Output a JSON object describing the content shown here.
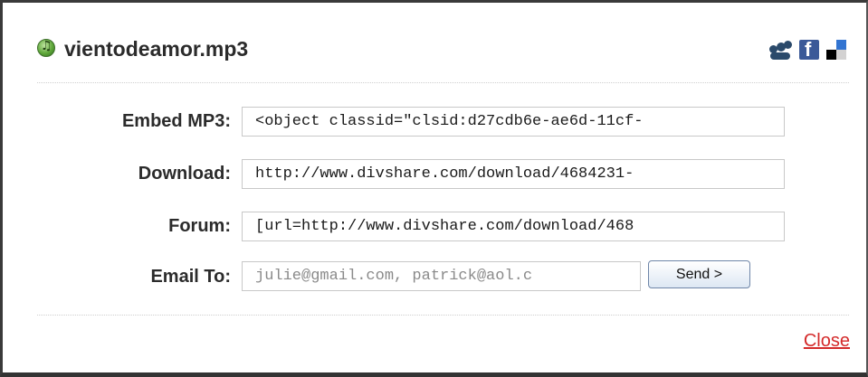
{
  "dialog": {
    "title": "vientodeamor.mp3",
    "file_icon": "music-file-icon",
    "share_icons": [
      "myspace-icon",
      "facebook-icon",
      "delicious-icon"
    ]
  },
  "rows": [
    {
      "label": "Embed MP3:",
      "value": "<object classid=\"clsid:d27cdb6e-ae6d-11cf-"
    },
    {
      "label": "Download:",
      "value": "http://www.divshare.com/download/4684231-"
    },
    {
      "label": "Forum:",
      "value": "[url=http://www.divshare.com/download/468"
    }
  ],
  "email": {
    "label": "Email To:",
    "placeholder": "julie@gmail.com, patrick@aol.c",
    "send_label": "Send >"
  },
  "close_label": "Close",
  "colors": {
    "link": "#d42a2a",
    "facebook": "#3b5998",
    "button_border": "#6f86a8"
  }
}
